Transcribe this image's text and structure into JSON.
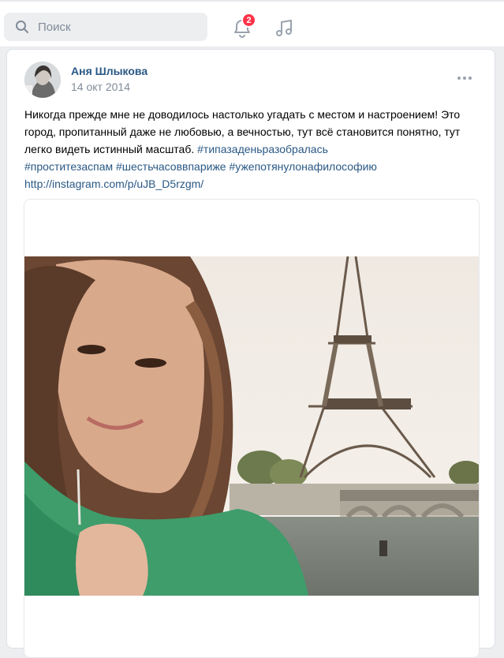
{
  "header": {
    "search_placeholder": "Поиск",
    "notifications_count": "2"
  },
  "post": {
    "author": "Аня Шлыкова",
    "date": "14 окт 2014",
    "text_plain": "Никогда прежде мне не доводилось настолько угадать с местом и настроением! Это город, пропитанный даже не любовью, а вечностью, тут всё становится понятно, тут легко видеть истинный масштаб. ",
    "tags": [
      "#типазаденьразобралась",
      "#проститезаспам",
      "#шестьчасоввпариже",
      "#ужепотянулонафилософию"
    ],
    "link": "http://instagram.com/p/uJB_D5rzgm/"
  },
  "colors": {
    "link": "#2a5885",
    "badge": "#ff3347",
    "muted": "#818c99"
  }
}
